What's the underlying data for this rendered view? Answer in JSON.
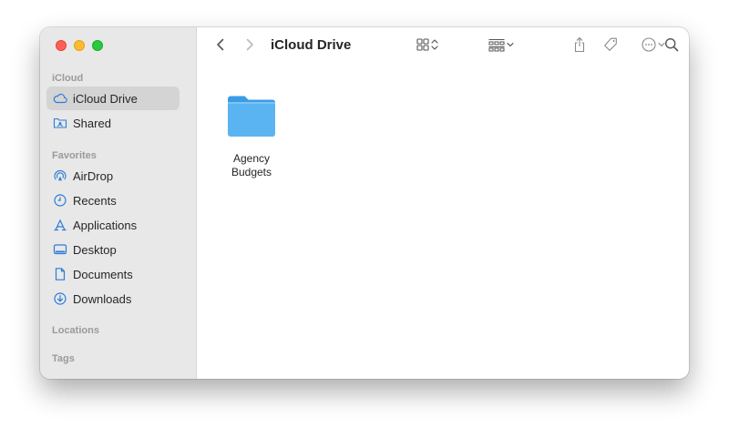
{
  "window": {
    "title": "iCloud Drive"
  },
  "sidebar": {
    "sections": {
      "icloud": "iCloud",
      "favorites": "Favorites",
      "locations": "Locations",
      "tags": "Tags"
    },
    "icloud_items": [
      {
        "label": "iCloud Drive",
        "icon": "cloud-icon",
        "selected": true
      },
      {
        "label": "Shared",
        "icon": "shared-folder-icon",
        "selected": false
      }
    ],
    "favorite_items": [
      {
        "label": "AirDrop",
        "icon": "airdrop-icon"
      },
      {
        "label": "Recents",
        "icon": "clock-icon"
      },
      {
        "label": "Applications",
        "icon": "applications-icon"
      },
      {
        "label": "Desktop",
        "icon": "desktop-icon"
      },
      {
        "label": "Documents",
        "icon": "document-icon"
      },
      {
        "label": "Downloads",
        "icon": "download-icon"
      }
    ]
  },
  "content": {
    "items": [
      {
        "label": "Agency Budgets",
        "label_line1": "Agency",
        "label_line2": "Budgets",
        "icon": "folder-icon"
      }
    ]
  },
  "colors": {
    "accent": "#2b7bd9",
    "folder": "#5ab4f2",
    "sidebar_bg": "#e8e8e8",
    "selected_bg": "#d4d4d4"
  }
}
